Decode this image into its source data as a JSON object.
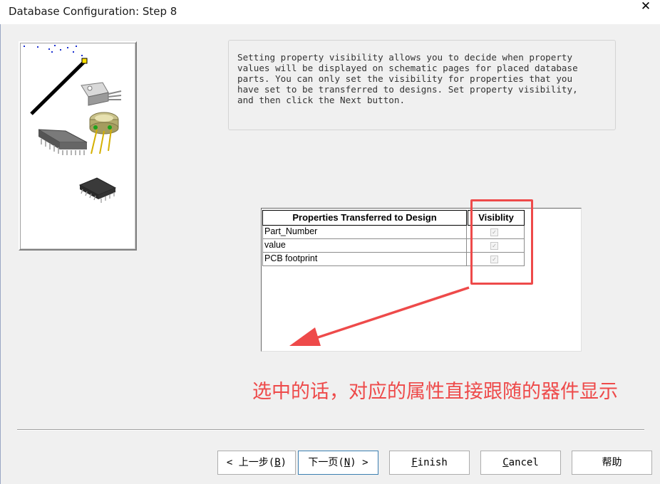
{
  "window": {
    "title": "Database Configuration: Step 8",
    "close_glyph": "✕"
  },
  "description": "Setting property visibility allows you to decide when property\nvalues will be displayed on schematic pages for placed database\nparts. You can only set the visibility for properties that you\nhave set to be transferred to designs. Set property visibility,\nand then click the Next button.",
  "grid": {
    "columns": [
      "Properties Transferred to Design",
      "Visiblity"
    ],
    "rows": [
      {
        "name": "Part_Number",
        "visible": true
      },
      {
        "name": "value",
        "visible": true
      },
      {
        "name": "PCB footprint",
        "visible": true
      }
    ]
  },
  "annotation": {
    "text": "选中的话，对应的属性直接跟随的器件显示",
    "color": "#ee4a4a"
  },
  "buttons": {
    "back": {
      "label": "< 上一步(B)",
      "pre": "<  上一步(",
      "key": "B",
      "post": ")"
    },
    "next": {
      "label": "下一页(N) >",
      "pre": "下一页(",
      "key": "N",
      "post": ")  >"
    },
    "finish": {
      "label": "Finish",
      "key": "F",
      "rest": "inish"
    },
    "cancel": {
      "label": "Cancel",
      "key": "C",
      "rest": "ancel"
    },
    "help": {
      "label": "帮助"
    }
  }
}
